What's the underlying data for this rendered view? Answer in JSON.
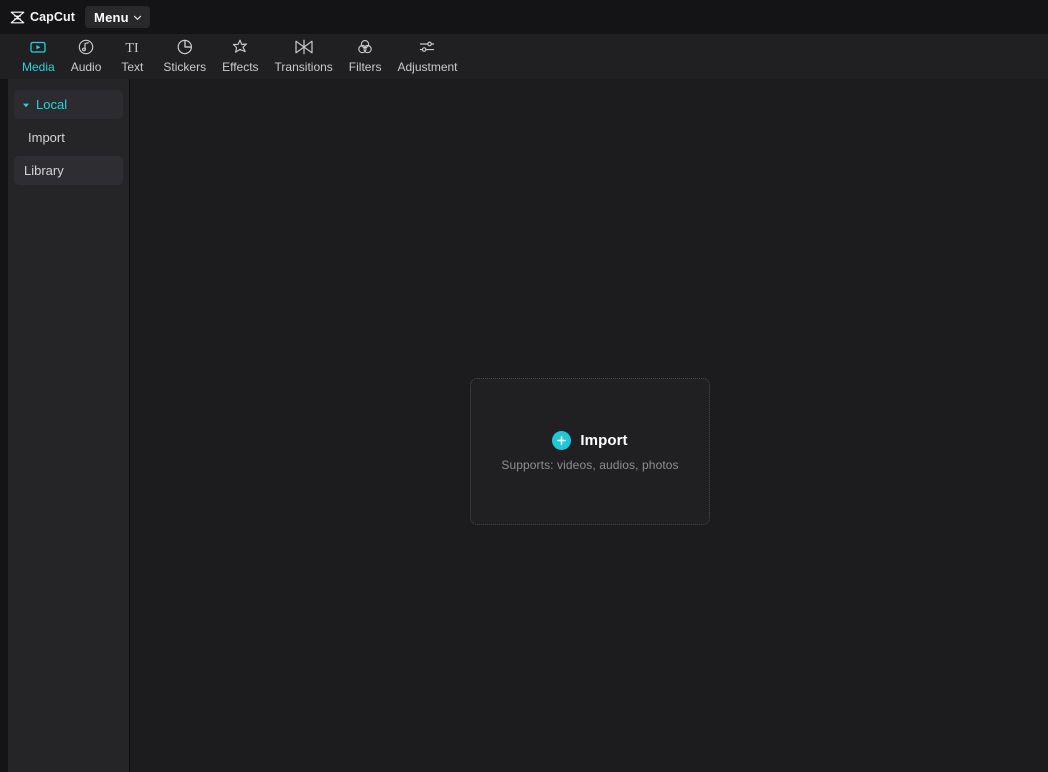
{
  "app": {
    "brand_name": "CapCut",
    "logo_icon": "capcut-logo-icon",
    "background": "#141416",
    "accent": "#2bd2dd",
    "panel_bg": "#252528",
    "canvas_bg": "#1c1c1f"
  },
  "titlebar": {
    "menu_label": "Menu",
    "menu_caret_icon": "chevron-down-icon"
  },
  "tabs": [
    {
      "label": "Media",
      "icon": "media-icon",
      "active": true
    },
    {
      "label": "Audio",
      "icon": "audio-icon",
      "active": false
    },
    {
      "label": "Text",
      "icon": "text-icon",
      "active": false
    },
    {
      "label": "Stickers",
      "icon": "stickers-icon",
      "active": false
    },
    {
      "label": "Effects",
      "icon": "effects-icon",
      "active": false
    },
    {
      "label": "Transitions",
      "icon": "transitions-icon",
      "active": false
    },
    {
      "label": "Filters",
      "icon": "filters-icon",
      "active": false
    },
    {
      "label": "Adjustment",
      "icon": "adjustment-icon",
      "active": false
    }
  ],
  "sidebar": {
    "items": [
      {
        "label": "Local",
        "icon": "caret-down-icon",
        "state": "group"
      },
      {
        "label": "Import",
        "icon": "",
        "state": "plain"
      },
      {
        "label": "Library",
        "icon": "",
        "state": "highlight"
      }
    ]
  },
  "import_card": {
    "plus_icon": "plus-icon",
    "title": "Import",
    "subtitle": "Supports: videos, audios, photos"
  }
}
